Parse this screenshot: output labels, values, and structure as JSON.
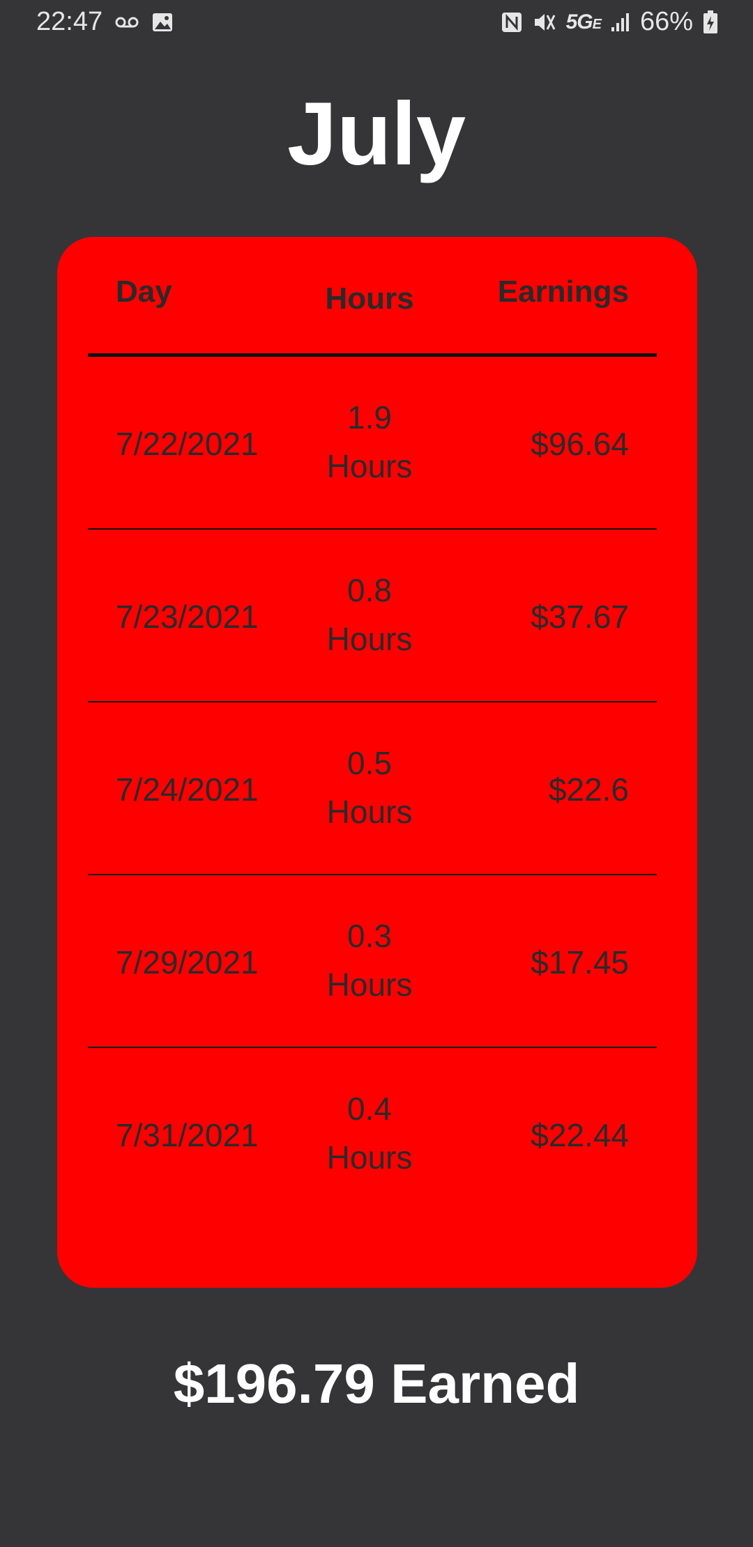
{
  "status_bar": {
    "time": "22:47",
    "network": "5G",
    "network_sub": "E",
    "battery": "66%"
  },
  "title": "July",
  "table": {
    "headers": {
      "day": "Day",
      "hours": "Hours",
      "earnings": "Earnings"
    },
    "rows": [
      {
        "day": "7/22/2021",
        "hours": "1.9",
        "hours_unit": "Hours",
        "earnings": "$96.64"
      },
      {
        "day": "7/23/2021",
        "hours": "0.8",
        "hours_unit": "Hours",
        "earnings": "$37.67"
      },
      {
        "day": "7/24/2021",
        "hours": "0.5",
        "hours_unit": "Hours",
        "earnings": "$22.6"
      },
      {
        "day": "7/29/2021",
        "hours": "0.3",
        "hours_unit": "Hours",
        "earnings": "$17.45"
      },
      {
        "day": "7/31/2021",
        "hours": "0.4",
        "hours_unit": "Hours",
        "earnings": "$22.44"
      }
    ]
  },
  "total": "$196.79 Earned",
  "colors": {
    "background": "#353537",
    "card": "#ff0000",
    "card_text": "#2a2a2a",
    "title_text": "#ffffff"
  },
  "icons": {
    "voicemail": "voicemail-icon",
    "image": "image-icon",
    "nfc": "nfc-icon",
    "mute": "mute-icon",
    "signal": "signal-icon",
    "battery": "battery-charging-icon"
  }
}
